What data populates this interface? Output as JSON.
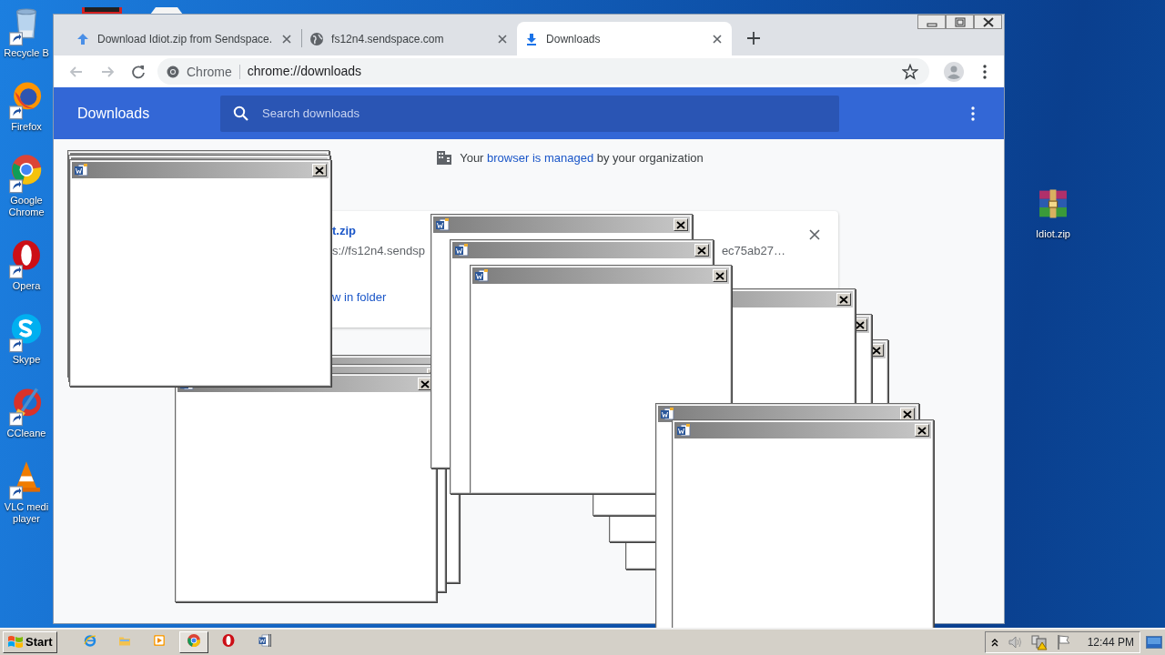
{
  "desktop_icons": [
    {
      "label": "Recycle B",
      "kind": "recycle"
    },
    {
      "label": "Firefox",
      "kind": "firefox"
    },
    {
      "label": "Google Chrome",
      "kind": "chrome"
    },
    {
      "label": "Opera",
      "kind": "opera"
    },
    {
      "label": "Skype",
      "kind": "skype"
    },
    {
      "label": "CCleane",
      "kind": "ccleaner"
    },
    {
      "label": "VLC medi player",
      "kind": "vlc"
    }
  ],
  "desktop_right_icons": [
    {
      "label": "Idiot.zip",
      "kind": "archive"
    }
  ],
  "browser": {
    "tabs": [
      {
        "title": "Download Idiot.zip from Sendspace.",
        "selected": false
      },
      {
        "title": "fs12n4.sendspace.com",
        "selected": false
      },
      {
        "title": "Downloads",
        "selected": true
      }
    ],
    "omnibox": {
      "chip": "Chrome",
      "url": "chrome://downloads"
    },
    "page": {
      "title": "Downloads",
      "search": {
        "placeholder": "Search downloads"
      },
      "managed_notice": {
        "before": "Your ",
        "link": "browser is managed",
        "after": " by your organization"
      },
      "download_card": {
        "file_name": "t.zip",
        "url": "s://fs12n4.sendsp",
        "hash": "ec75ab27…",
        "action": "w in folder"
      }
    }
  },
  "taskbar": {
    "start": "Start",
    "apps": [
      {
        "kind": "ie",
        "active": false
      },
      {
        "kind": "explorer",
        "active": false
      },
      {
        "kind": "media",
        "active": false
      },
      {
        "kind": "chrome",
        "active": true
      },
      {
        "kind": "opera",
        "active": false
      },
      {
        "kind": "word",
        "active": false
      }
    ],
    "clock": "12:44 PM"
  }
}
